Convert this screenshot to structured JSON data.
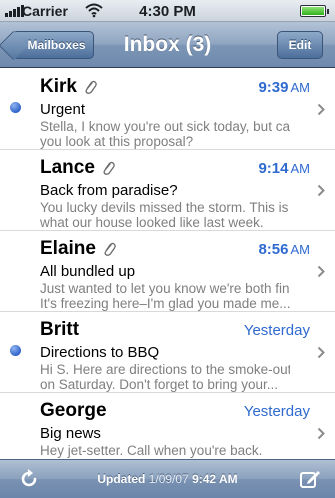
{
  "status_bar": {
    "carrier": "Carrier",
    "time": "4:30 PM"
  },
  "nav": {
    "back_label": "Mailboxes",
    "title": "Inbox (3)",
    "edit_label": "Edit"
  },
  "messages": [
    {
      "sender": "Kirk",
      "attachment": true,
      "unread": true,
      "time": "9:39",
      "ampm": "AM",
      "subject": "Urgent",
      "preview_line1": "Stella, I know you're out sick today, but can",
      "preview_line2": "you look at this proposal?"
    },
    {
      "sender": "Lance",
      "attachment": true,
      "unread": false,
      "time": "9:14",
      "ampm": "AM",
      "subject": "Back from paradise?",
      "preview_line1": "You lucky devils missed the storm. This is",
      "preview_line2": "what our house looked like last week."
    },
    {
      "sender": "Elaine",
      "attachment": true,
      "unread": false,
      "time": "8:56",
      "ampm": "AM",
      "subject": "All bundled up",
      "preview_line1": "Just wanted to let you know we're both fine.",
      "preview_line2": "It's freezing here–I'm glad you made me..."
    },
    {
      "sender": "Britt",
      "attachment": false,
      "unread": true,
      "time": "Yesterday",
      "ampm": "",
      "subject": "Directions to BBQ",
      "preview_line1": "Hi S. Here are directions to the smoke-out",
      "preview_line2": "on Saturday. Don't forget to bring your..."
    },
    {
      "sender": "George",
      "attachment": false,
      "unread": false,
      "time": "Yesterday",
      "ampm": "",
      "subject": "Big news",
      "preview_line1": "Hey jet-setter. Call when you're back.",
      "preview_line2": ""
    }
  ],
  "toolbar": {
    "updated_label": "Updated",
    "updated_date": "1/09/07",
    "updated_time": "9:42 AM"
  },
  "icons": {
    "refresh": "refresh-icon",
    "compose": "compose-icon",
    "attachment": "paperclip-icon",
    "chevron": "chevron-right-icon"
  },
  "colors": {
    "accent_blue": "#2f6ad0",
    "unread_dot": "#2f63c8",
    "preview_gray": "#7f7f7f"
  }
}
